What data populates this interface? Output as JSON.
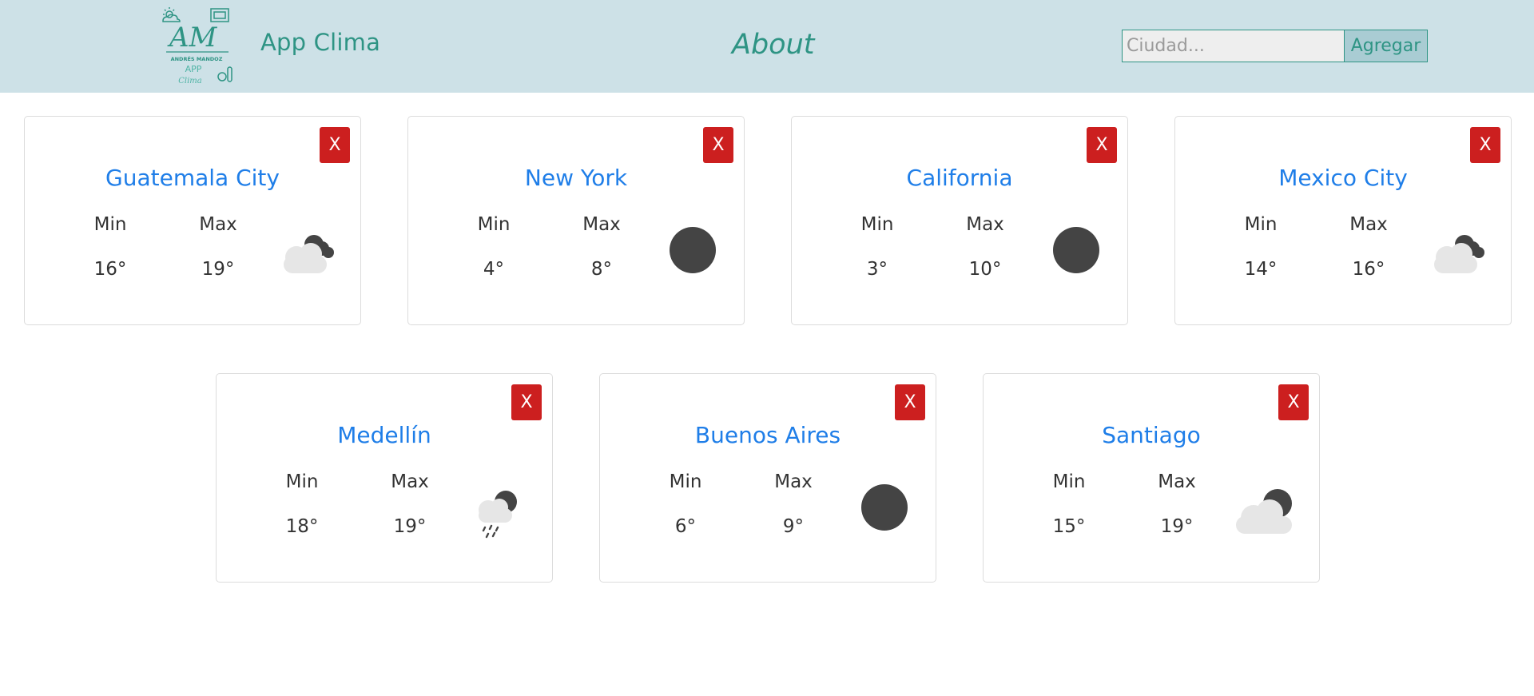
{
  "header": {
    "logo_text": "AM",
    "logo_subtext": "ANDRÉS MANDOZ",
    "logo_app": "APP",
    "logo_clima": "Clima",
    "app_title": "App Clima",
    "about": "About",
    "search_placeholder": "Ciudad...",
    "add_label": "Agregar",
    "accent_color": "#2e9484",
    "navbar_color": "#cde1e7"
  },
  "cards": [
    {
      "city": "Guatemala City",
      "min_label": "Min",
      "max_label": "Max",
      "min": "16°",
      "max": "19°",
      "icon": "partly-cloudy-night-icon",
      "close": "X"
    },
    {
      "city": "New York",
      "min_label": "Min",
      "max_label": "Max",
      "min": "4°",
      "max": "8°",
      "icon": "clear-night-icon",
      "close": "X"
    },
    {
      "city": "California",
      "min_label": "Min",
      "max_label": "Max",
      "min": "3°",
      "max": "10°",
      "icon": "clear-night-icon",
      "close": "X"
    },
    {
      "city": "Mexico City",
      "min_label": "Min",
      "max_label": "Max",
      "min": "14°",
      "max": "16°",
      "icon": "partly-cloudy-night-icon",
      "close": "X"
    },
    {
      "city": "Medellín",
      "min_label": "Min",
      "max_label": "Max",
      "min": "18°",
      "max": "19°",
      "icon": "rain-night-icon",
      "close": "X"
    },
    {
      "city": "Buenos Aires",
      "min_label": "Min",
      "max_label": "Max",
      "min": "6°",
      "max": "9°",
      "icon": "clear-night-icon",
      "close": "X"
    },
    {
      "city": "Santiago",
      "min_label": "Min",
      "max_label": "Max",
      "min": "15°",
      "max": "19°",
      "icon": "cloudy-night-icon",
      "close": "X"
    }
  ],
  "colors": {
    "city": "#1f7ee8",
    "close_button": "#cc1f1f"
  }
}
